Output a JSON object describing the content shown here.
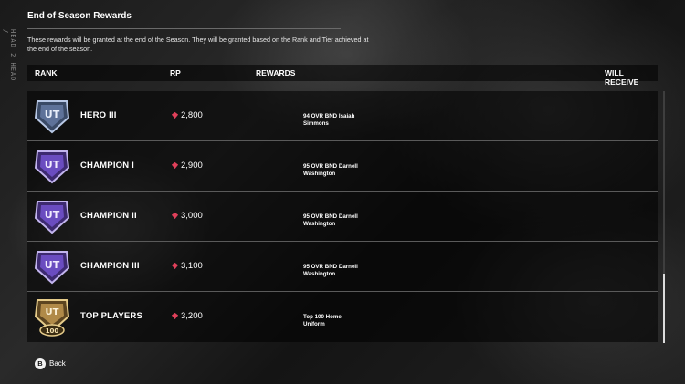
{
  "side_label": "HEAD 2 HEAD /",
  "title": "End of Season Rewards",
  "description": "These rewards will be granted at the end of the Season. They will be granted based on the Rank and Tier achieved at the end of the season.",
  "columns": {
    "rank": "RANK",
    "rp": "RP",
    "rewards": "REWARDS",
    "will_receive": "WILL RECEIVE"
  },
  "rows": [
    {
      "rank": "HERO III",
      "rp": "2,800",
      "reward_line1": "94 OVR BND Isaiah",
      "reward_line2": "Simmons",
      "badge": "hero-badge-icon",
      "badge_color": "#8fa3c8"
    },
    {
      "rank": "CHAMPION I",
      "rp": "2,900",
      "reward_line1": "95 OVR BND Darnell",
      "reward_line2": "Washington",
      "badge": "champion-badge-icon",
      "badge_color": "#7a5cc4"
    },
    {
      "rank": "CHAMPION II",
      "rp": "3,000",
      "reward_line1": "95 OVR BND Darnell",
      "reward_line2": "Washington",
      "badge": "champion-badge-icon",
      "badge_color": "#7a5cc4"
    },
    {
      "rank": "CHAMPION III",
      "rp": "3,100",
      "reward_line1": "95 OVR BND Darnell",
      "reward_line2": "Washington",
      "badge": "champion-badge-icon",
      "badge_color": "#7a5cc4"
    },
    {
      "rank": "TOP PLAYERS",
      "rp": "3,200",
      "reward_line1": "Top 100 Home",
      "reward_line2": "Uniform",
      "badge": "top-100-badge-icon",
      "badge_color": "#c9a862"
    }
  ],
  "rp_icon": "rp-gem-icon",
  "rp_icon_color": "#e0405a",
  "footer": {
    "back_button_glyph": "B",
    "back_label": "Back"
  },
  "scroll_progress": 0.72
}
